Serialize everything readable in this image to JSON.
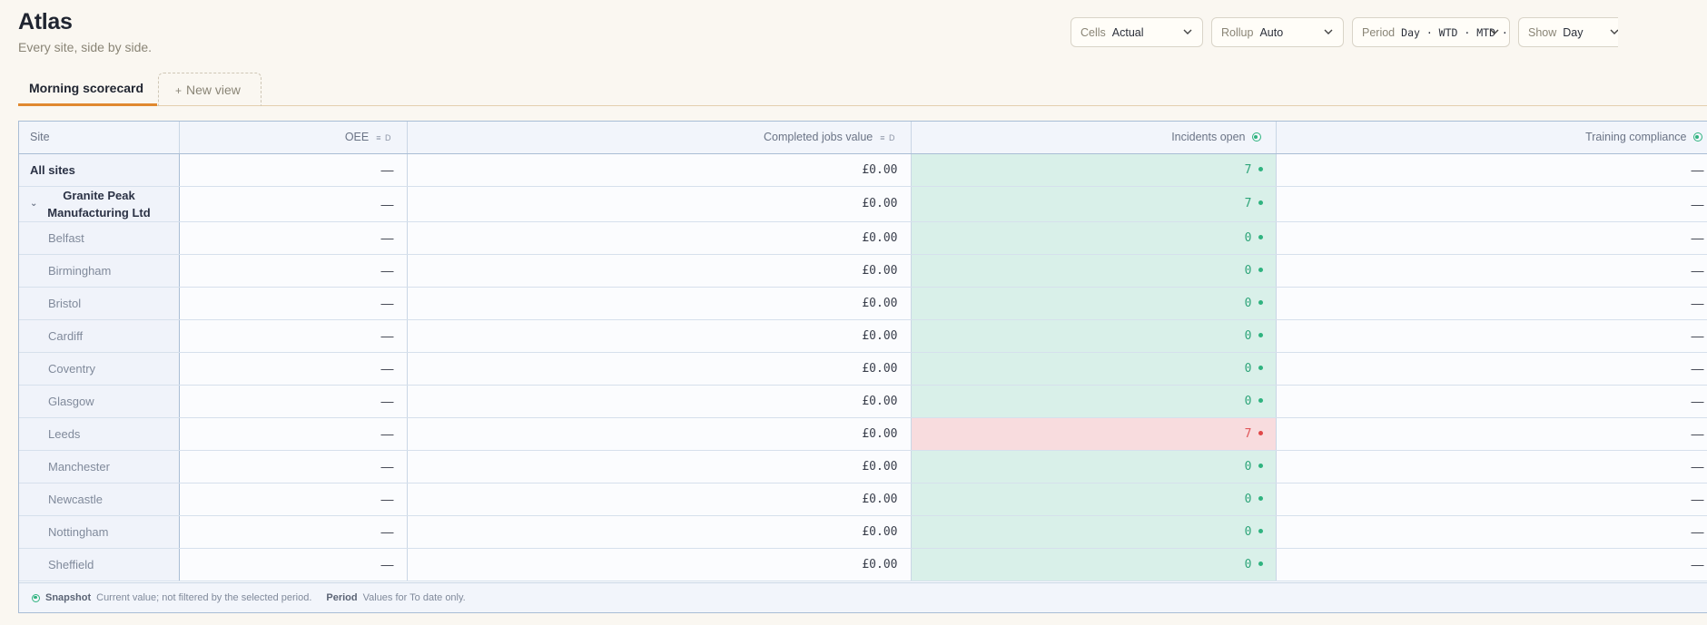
{
  "app": {
    "title": "Atlas",
    "subtitle": "Every site, side by side."
  },
  "controls": [
    {
      "label": "Cells",
      "value": "Actual"
    },
    {
      "label": "Rollup",
      "value": "Auto"
    },
    {
      "label": "Period",
      "value": "Day · WTD · MTD · QTD"
    },
    {
      "label": "Show",
      "value": "Day"
    }
  ],
  "tabs": {
    "active": "Morning scorecard",
    "new_view": "New view"
  },
  "table": {
    "headers": {
      "site": "Site",
      "oee": "OEE",
      "jobs": "Completed jobs value",
      "incidents": "Incidents open",
      "training": "Training compliance"
    },
    "header_icons": {
      "oee": "≡ D",
      "jobs": "≡ D"
    },
    "rows": [
      {
        "site": "All sites",
        "oee": "—",
        "jobs": "£0.00",
        "incidents": "7",
        "incident_status": "good",
        "training": "—",
        "kind": "total"
      },
      {
        "site": "Granite Peak Manufacturing Ltd",
        "oee": "—",
        "jobs": "£0.00",
        "incidents": "7",
        "incident_status": "good",
        "training": "—",
        "kind": "group"
      },
      {
        "site": "Belfast",
        "oee": "—",
        "jobs": "£0.00",
        "incidents": "0",
        "incident_status": "good",
        "training": "—",
        "kind": "child"
      },
      {
        "site": "Birmingham",
        "oee": "—",
        "jobs": "£0.00",
        "incidents": "0",
        "incident_status": "good",
        "training": "—",
        "kind": "child"
      },
      {
        "site": "Bristol",
        "oee": "—",
        "jobs": "£0.00",
        "incidents": "0",
        "incident_status": "good",
        "training": "—",
        "kind": "child"
      },
      {
        "site": "Cardiff",
        "oee": "—",
        "jobs": "£0.00",
        "incidents": "0",
        "incident_status": "good",
        "training": "—",
        "kind": "child"
      },
      {
        "site": "Coventry",
        "oee": "—",
        "jobs": "£0.00",
        "incidents": "0",
        "incident_status": "good",
        "training": "—",
        "kind": "child"
      },
      {
        "site": "Glasgow",
        "oee": "—",
        "jobs": "£0.00",
        "incidents": "0",
        "incident_status": "good",
        "training": "—",
        "kind": "child"
      },
      {
        "site": "Leeds",
        "oee": "—",
        "jobs": "£0.00",
        "incidents": "7",
        "incident_status": "bad",
        "training": "—",
        "kind": "child"
      },
      {
        "site": "Manchester",
        "oee": "—",
        "jobs": "£0.00",
        "incidents": "0",
        "incident_status": "good",
        "training": "—",
        "kind": "child"
      },
      {
        "site": "Newcastle",
        "oee": "—",
        "jobs": "£0.00",
        "incidents": "0",
        "incident_status": "good",
        "training": "—",
        "kind": "child"
      },
      {
        "site": "Nottingham",
        "oee": "—",
        "jobs": "£0.00",
        "incidents": "0",
        "incident_status": "good",
        "training": "—",
        "kind": "child"
      },
      {
        "site": "Sheffield",
        "oee": "—",
        "jobs": "£0.00",
        "incidents": "0",
        "incident_status": "good",
        "training": "—",
        "kind": "child"
      }
    ]
  },
  "footer": {
    "snapshot_label": "Snapshot",
    "snapshot_text": "Current value; not filtered by the selected period.",
    "period_label": "Period",
    "period_text": "Values for To date only."
  },
  "colors": {
    "accent": "#e0892f",
    "good": "#2fb37f",
    "good_bg": "#d9f0e9",
    "bad": "#e04848",
    "bad_bg": "#f8dcde"
  },
  "icons": {
    "dropdown": "chevron-down-icon",
    "new_view": "plus-icon",
    "snapshot": "snapshot-dot-icon",
    "expand": "chevron-down-icon"
  }
}
